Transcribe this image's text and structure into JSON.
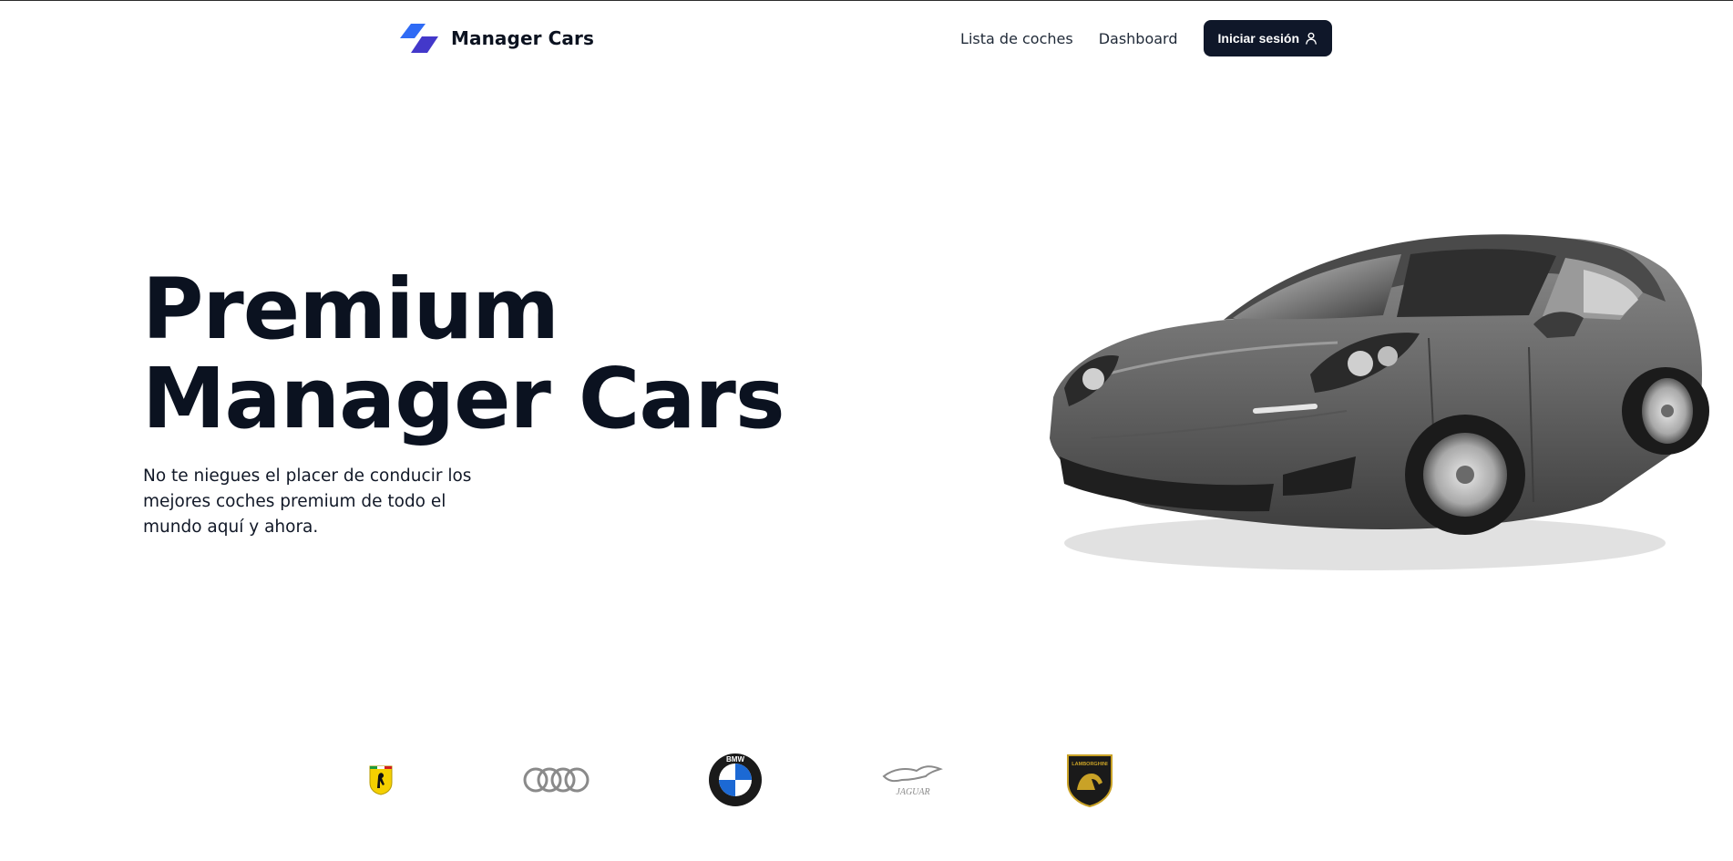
{
  "header": {
    "brand_name": "Manager Cars",
    "nav": {
      "cars_list_label": "Lista de coches",
      "dashboard_label": "Dashboard"
    },
    "login_label": "Iniciar sesión",
    "login_icon": "user-icon"
  },
  "hero": {
    "title_line1": "Premium",
    "title_line2": "Manager Cars",
    "description": "No te niegues el placer de conducir los mejores coches premium de todo el mundo aquí y ahora."
  },
  "brands": {
    "logos": [
      "ferrari-logo",
      "audi-logo",
      "bmw-logo",
      "jaguar-logo",
      "lamborghini-logo"
    ],
    "bmw_text": "BMW",
    "jaguar_text": "JAGUAR",
    "lamborghini_text": "LAMBORGHINI"
  },
  "colors": {
    "accent_blue": "#3b63f3",
    "accent_indigo": "#4338ca",
    "dark": "#0f1729"
  }
}
